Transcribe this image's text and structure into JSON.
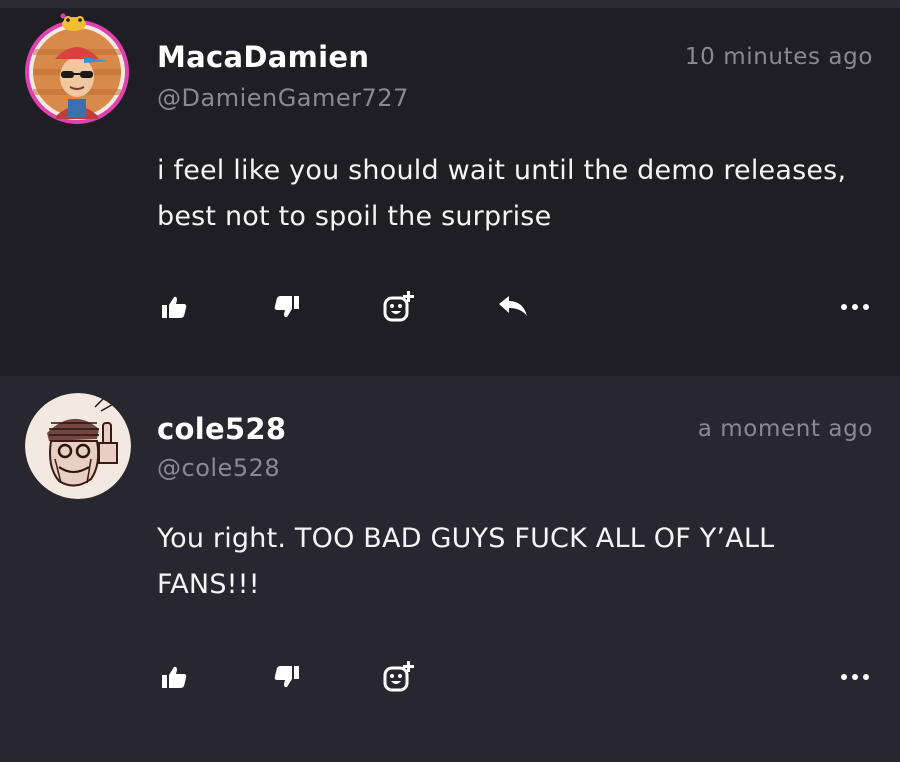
{
  "comments": [
    {
      "name": "MacaDamien",
      "handle": "@DamienGamer727",
      "time": "10 minutes ago",
      "text": "i feel like you should wait until the demo releases, best not to spoil the surprise",
      "avatar": "avatar-gamer-sunglasses",
      "has_reply": true
    },
    {
      "name": "cole528",
      "handle": "@cole528",
      "time": "a moment ago",
      "text": "You right. TOO BAD GUYS FUCK ALL OF Y’ALL FANS!!!",
      "avatar": "avatar-sketch-middle-finger",
      "has_reply": false
    }
  ],
  "icons": {
    "like": "thumbs-up-icon",
    "dislike": "thumbs-down-icon",
    "react": "add-reaction-icon",
    "reply": "reply-arrow-icon",
    "more": "more-options-icon"
  },
  "colors": {
    "background_dark": "#1f1e24",
    "background_light": "#28272f",
    "text_primary": "#ffffff",
    "text_secondary": "#8a8992",
    "avatar_ring": "#e040b0"
  }
}
